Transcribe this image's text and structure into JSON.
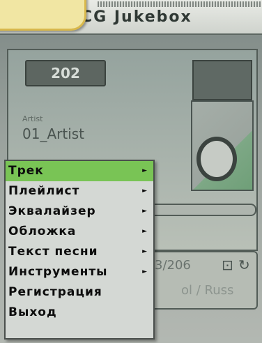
{
  "window": {
    "title": "CG Jukebox"
  },
  "player": {
    "counter": "202",
    "artist_label": "Artist",
    "artist_name": "01_Artist",
    "track_number": "3/206",
    "track_title": "ol / Russ"
  },
  "menu": {
    "items": [
      {
        "label": "Трек",
        "has_submenu": true,
        "selected": true
      },
      {
        "label": "Плейлист",
        "has_submenu": true,
        "selected": false
      },
      {
        "label": "Эквалайзер",
        "has_submenu": true,
        "selected": false
      },
      {
        "label": "Обложка",
        "has_submenu": true,
        "selected": false
      },
      {
        "label": "Текст песни",
        "has_submenu": true,
        "selected": false
      },
      {
        "label": "Инструменты",
        "has_submenu": true,
        "selected": false
      },
      {
        "label": "Регистрация",
        "has_submenu": false,
        "selected": false
      },
      {
        "label": "Выход",
        "has_submenu": false,
        "selected": false
      }
    ],
    "arrow_glyph": "►"
  },
  "icons": {
    "shuffle": "⊡",
    "repeat": "↻"
  },
  "colors": {
    "selected_item": "#79c455"
  }
}
